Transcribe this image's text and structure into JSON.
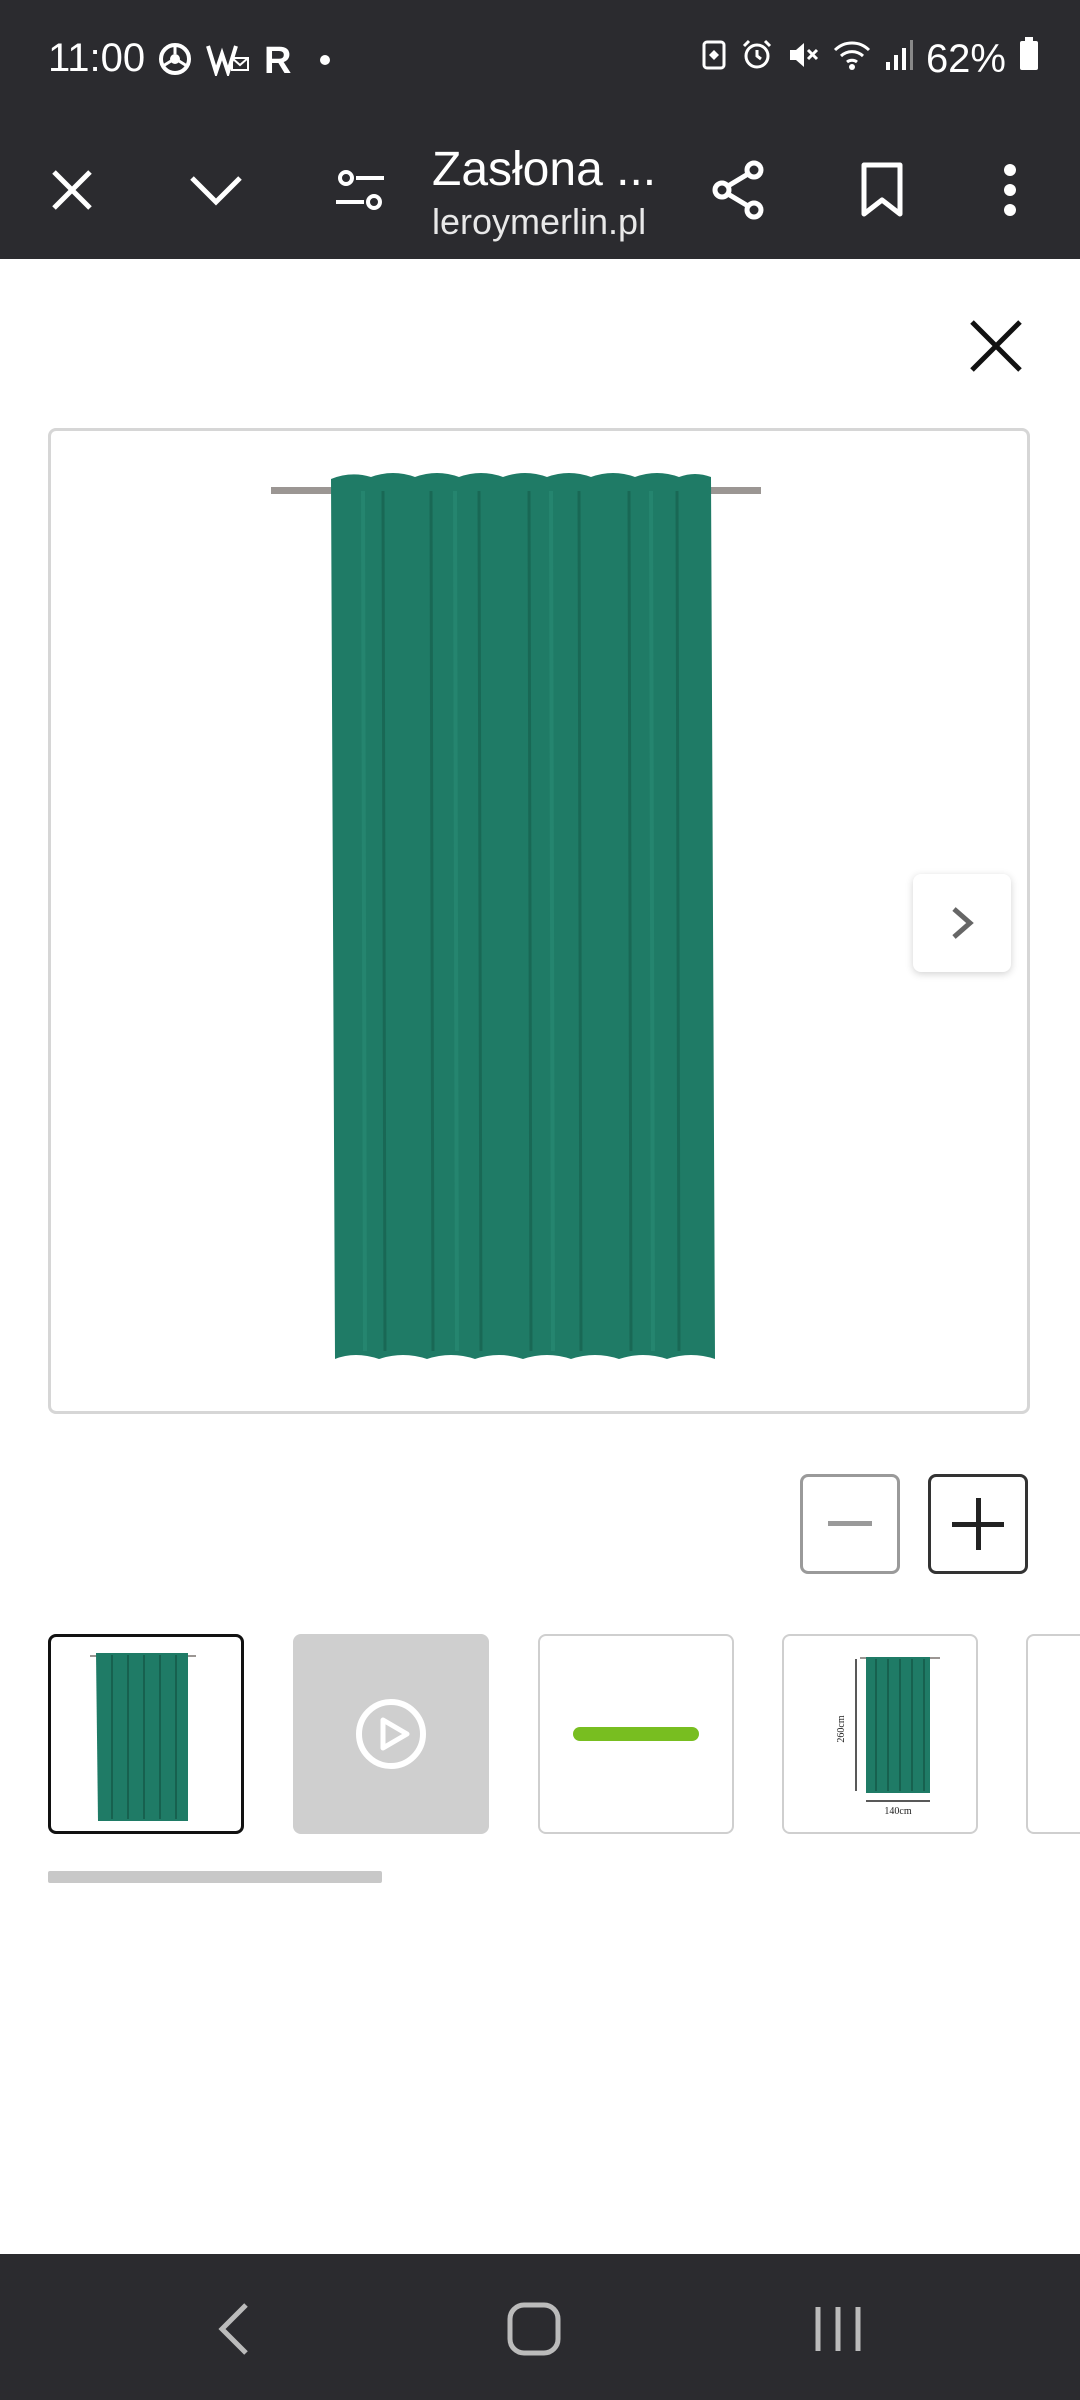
{
  "status_bar": {
    "time": "11:00",
    "left_icons": [
      "chrome-icon",
      "mail-icon",
      "r-icon",
      "dot-icon"
    ],
    "r_letter": "R",
    "battery_percent": "62%",
    "right_icons": [
      "battery-saver-icon",
      "alarm-icon",
      "mute-icon",
      "wifi-icon",
      "signal-icon",
      "battery-icon"
    ]
  },
  "toolbar": {
    "title": "Zasłona ...",
    "url": "leroymerlin.pl",
    "icons": [
      "close-icon",
      "chevron-down-icon",
      "filter-icon",
      "share-icon",
      "bookmark-icon",
      "more-vert-icon"
    ]
  },
  "gallery": {
    "main_image_icon": "curtain-image",
    "thumbnails": [
      {
        "type": "image",
        "icon": "curtain-thumbnail",
        "selected": true
      },
      {
        "type": "video",
        "icon": "play-icon",
        "selected": false
      },
      {
        "type": "image",
        "icon": "green-bar-thumbnail",
        "selected": false
      },
      {
        "type": "image",
        "icon": "curtain-dimensions-thumbnail",
        "selected": false
      }
    ],
    "dimension_height": "260cm",
    "dimension_width": "140cm"
  },
  "colors": {
    "curtain": "#1f7b66",
    "accent_green": "#78be20",
    "system_bar": "#2b2b2f"
  },
  "nav_bar": {
    "icons": [
      "back-icon",
      "home-icon",
      "recents-icon"
    ]
  }
}
